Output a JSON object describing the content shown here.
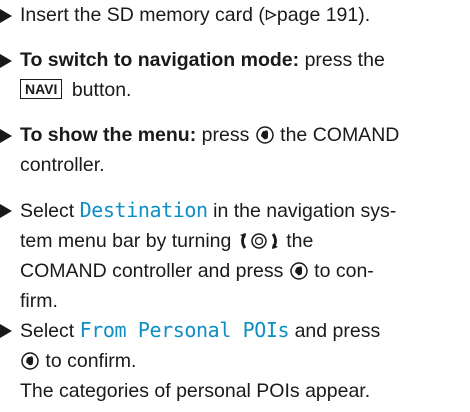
{
  "steps": [
    {
      "t1": "Insert the SD memory card (",
      "page_ref": "page 191",
      "t2": ")."
    },
    {
      "bold": "To switch to navigation mode:",
      "t1": " press the",
      "key": "NAVI",
      "t2": " button."
    },
    {
      "bold": "To show the menu:",
      "t1": " press",
      "t2": " the COMAND",
      "line2": "controller."
    },
    {
      "t1": "Select ",
      "mono": "Destination",
      "t2": " in the navigation sys-",
      "line2": "tem menu bar by turning",
      "line2b": " the",
      "line3": "COMAND controller and press",
      "line3b": " to con-",
      "line4": "firm."
    },
    {
      "t1": "Select ",
      "mono": "From Personal POIs",
      "t2": " and press",
      "line2b": " to confirm.",
      "result": "The categories of personal POIs appear."
    }
  ]
}
